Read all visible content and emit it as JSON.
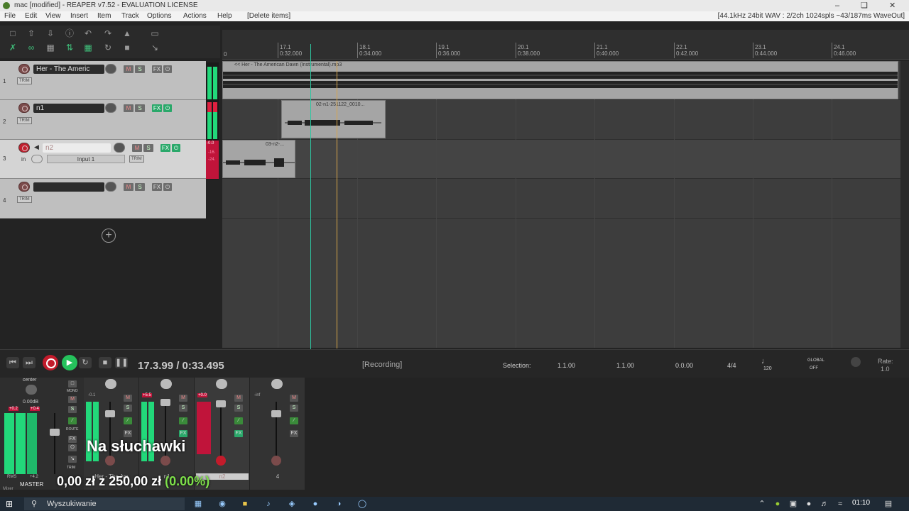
{
  "window": {
    "title": "mac [modified] - REAPER v7.52 - EVALUATION LICENSE",
    "minimize_icon": "minimize-icon",
    "restore_icon": "restore-icon",
    "close_icon": "close-icon"
  },
  "menu": {
    "items": [
      "File",
      "Edit",
      "View",
      "Insert",
      "Item",
      "Track",
      "Options",
      "Actions",
      "Help",
      "[Delete items]"
    ],
    "audio_info": "[44.1kHz 24bit WAV : 2/2ch 1024spls ~43/187ms WaveOut]"
  },
  "ruler": {
    "marks": [
      {
        "bar": "17.1",
        "time": "0:32.000"
      },
      {
        "bar": "18.1",
        "time": "0:34.000"
      },
      {
        "bar": "19.1",
        "time": "0:36.000"
      },
      {
        "bar": "20.1",
        "time": "0:38.000"
      },
      {
        "bar": "21.1",
        "time": "0:40.000"
      },
      {
        "bar": "22.1",
        "time": "0:42.000"
      },
      {
        "bar": "23.1",
        "time": "0:44.000"
      },
      {
        "bar": "24.1",
        "time": "0:46.000"
      }
    ],
    "zero": "0"
  },
  "tracks": [
    {
      "num": "1",
      "name": "Her - The Americ",
      "mute": "M",
      "solo": "S",
      "fx": "FX",
      "trim": "TRIM"
    },
    {
      "num": "2",
      "name": "n1",
      "mute": "M",
      "solo": "S",
      "fx": "FX",
      "trim": "TRIM"
    },
    {
      "num": "3",
      "name": "n2",
      "mute": "M",
      "solo": "S",
      "fx": "FX",
      "trim": "TRIM",
      "input_label": "in",
      "input": "Input 1"
    },
    {
      "num": "4",
      "name": "",
      "mute": "M",
      "solo": "S",
      "fx": "FX",
      "trim": "TRIM"
    }
  ],
  "meter_labels": {
    "t3_db": "-0.0",
    "t3_a": "-16.",
    "t3_b": "-24."
  },
  "items": [
    {
      "name": "<< Her - The American Dawn (Instrumental).mp3"
    },
    {
      "name": "02-n1-251122_0010..."
    },
    {
      "name": "03-n2-..."
    }
  ],
  "transport": {
    "position": "17.3.99 / 0:33.495",
    "status": "[Recording]",
    "selection_label": "Selection:",
    "sel_start": "1.1.00",
    "sel_end": "1.1.00",
    "sel_len": "0.0.00",
    "time_sig": "4/4",
    "bpm": "120",
    "global_label": "GLOBAL",
    "global_state": "OFF",
    "rate_label": "Rate:",
    "rate_value": "1.0"
  },
  "mixer": {
    "master_pan": "center",
    "master_db": "0.00dB",
    "master_peak_a": "+0.2",
    "master_peak_b": "+0.4",
    "master_rms": "RMS",
    "master_rms_val": "+4.2",
    "master_label": "MASTER",
    "mono_label": "MONO",
    "route_label": "ROUTE",
    "fx_label": "FX",
    "trim_label": "TRIM",
    "mixer_tab": "Mixer",
    "strips": [
      {
        "name": "Her - The Am",
        "peak": "-0.1"
      },
      {
        "name": "n1",
        "peak": "+5.5"
      },
      {
        "name": "n2",
        "peak": "+0.0"
      },
      {
        "name": "4",
        "peak": "-inf"
      }
    ]
  },
  "overlay": {
    "subtitle": "Na słuchawki",
    "money_main": "0,00 zł",
    "money_z": "z",
    "money_goal": "250,00 zł",
    "money_pct": "(0.00%)"
  },
  "taskbar": {
    "search": "Wyszukiwanie",
    "time": "01:10"
  },
  "colors": {
    "accent_green": "#22d87a",
    "record_red": "#c31b2b",
    "cursor_teal": "#2ec7a1",
    "edit_cursor": "#d9a64a"
  }
}
